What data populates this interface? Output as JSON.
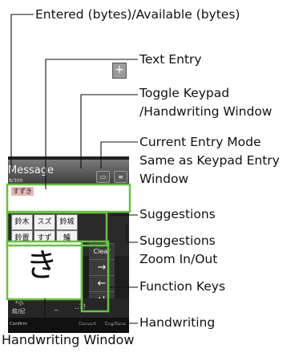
{
  "annotations": {
    "entered_available": "Entered (bytes)/Available (bytes)",
    "text_entry": "Text Entry",
    "toggle_1": "Toggle Keypad",
    "toggle_2": "/Handwriting Window",
    "mode_1": "Current Entry Mode",
    "mode_2": "Same as Keypad Entry",
    "mode_3": "Window",
    "suggestions": "Suggestions",
    "zoom_1": "Suggestions",
    "zoom_2": "Zoom In/Out",
    "function_keys": "Function Keys",
    "handwriting": "Handwriting"
  },
  "caption": "Handwriting Window",
  "screen": {
    "title": "Message",
    "count": "8/300",
    "toggle_icon": "keypad-icon",
    "mode_icon": "menu-icon",
    "entry_text": "すずき",
    "suggestions": [
      "鈴木",
      "スズキ",
      "鈴城",
      "鈴置",
      "すずき",
      "鱸"
    ],
    "zoom_label": "+",
    "handwritten_char": "き",
    "function_keys": [
      "Clear",
      "→",
      "←",
      "↵"
    ],
    "keys": [
      "*小",
      "絵/記",
      "_",
      "..?!"
    ],
    "softkeys": [
      "Confirm",
      "Convert",
      "Eng/Kana"
    ]
  }
}
